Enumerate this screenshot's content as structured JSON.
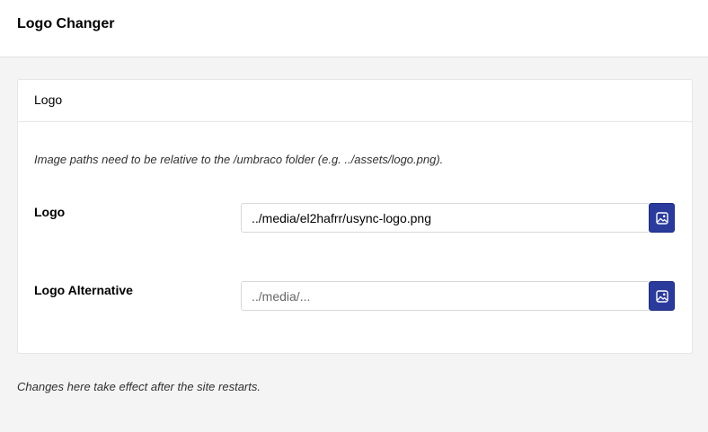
{
  "header": {
    "title": "Logo Changer"
  },
  "panel": {
    "title": "Logo",
    "hint": "Image paths need to be relative to the /umbraco folder (e.g. ../assets/logo.png).",
    "fields": [
      {
        "label": "Logo",
        "value": "../media/el2hafrr/usync-logo.png",
        "placeholder": "",
        "button_icon": "image-icon"
      },
      {
        "label": "Logo Alternative",
        "value": "",
        "placeholder": "../media/...",
        "button_icon": "image-icon"
      }
    ]
  },
  "footer": {
    "note": "Changes here take effect after the site restarts."
  },
  "colors": {
    "accent": "#2b3b9c",
    "background": "#f4f4f4",
    "panel": "#ffffff"
  }
}
